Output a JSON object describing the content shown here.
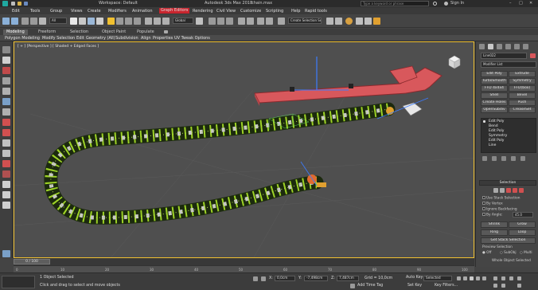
{
  "titlebar": {
    "workspace": "Workspace: Default",
    "app_title": "Autodesk 3ds Max 2018",
    "file_name": "chain.max",
    "search_placeholder": "Type a keyword or phrase",
    "sign_in": "Sign In"
  },
  "menu": [
    "Edit",
    "Tools",
    "Group",
    "Views",
    "Create",
    "Modifiers",
    "Animation",
    "Graph Editors",
    "Rendering",
    "Civil View",
    "Customize",
    "Scripting",
    "Help",
    "Rapid tools"
  ],
  "toolbar": {
    "selection_filter": "All",
    "ref_coord": "Global",
    "named_selection": "Create Selection Se"
  },
  "ribbon": {
    "tabs": [
      "Modeling",
      "Freeform",
      "Selection",
      "Object Paint",
      "Populate"
    ],
    "panels": [
      "Polygon Modeling",
      "Modify Selection",
      "Edit",
      "Geometry (All)",
      "Subdivision",
      "Align",
      "Properties",
      "UV Tweak Options"
    ]
  },
  "viewport": {
    "label": "[ + ] [Perspective ] [ Shaded + Edged Faces ]"
  },
  "command_panel": {
    "object_name": "Line022",
    "modifier_list": "Modifier List",
    "modifier_buttons": [
      "Edit Poly",
      "Extrude",
      "TurboSmooth",
      "Symmetry",
      "FFD 4x4x4",
      "FFD(box)",
      "Shell",
      "Bevel",
      "Create Holes",
      "Push",
      "OpenSubdiv",
      "CreaseSet"
    ],
    "stack": [
      "Edit Poly",
      "Bend",
      "Edit Poly",
      "Symmetry",
      "Edit Poly",
      "Line"
    ],
    "selection_header": "Selection",
    "selection_options": [
      "Use Stack Selection",
      "By Vertex",
      "Ignore Backfacing",
      "By Angle:"
    ],
    "angle_value": "45.0",
    "shrink": "Shrink",
    "grow": "Grow",
    "ring": "Ring",
    "loop": "Loop",
    "get_stack_selection": "Get Stack Selection",
    "preview_header": "Preview Selection",
    "preview_options": [
      "Off",
      "SubObj",
      "Multi"
    ],
    "status_text": "Whole Object Selected"
  },
  "timeline": {
    "frame_display": "0 / 100",
    "ticks": [
      "0",
      "10",
      "20",
      "30",
      "40",
      "50",
      "60",
      "70",
      "80",
      "90",
      "100"
    ]
  },
  "status": {
    "selection_count": "1 Object Selected",
    "prompt": "Click and drag to select and move objects",
    "x_label": "X:",
    "x_value": "0,0cm",
    "y_label": "Y:",
    "y_value": "-7,498cm",
    "z_label": "Z:",
    "z_value": "7,487cm",
    "grid": "Grid = 10,0cm",
    "add_time_tag": "Add Time Tag",
    "auto_key": "Auto Key",
    "set_key": "Set Key",
    "selected": "Selected",
    "key_filters": "Key Filters..."
  },
  "colors": {
    "accent_red": "#c8252e",
    "chain_green": "#9dd226",
    "arrow_red": "#d8585c",
    "viewport_border": "#f0c030"
  }
}
